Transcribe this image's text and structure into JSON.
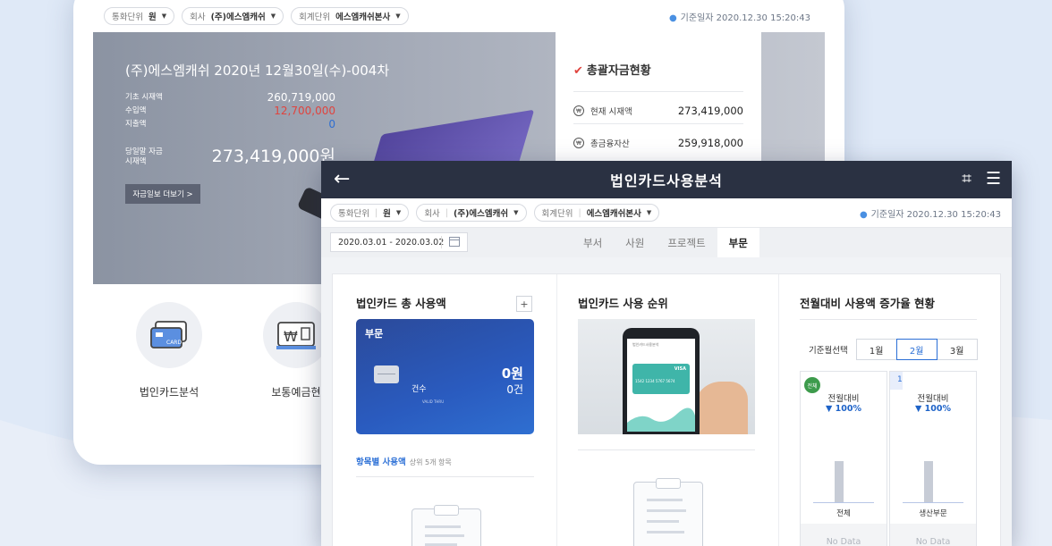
{
  "colors": {
    "header_bg": "#2a3142",
    "accent": "#2b6fd6",
    "negative": "#e0443e",
    "positive": "#2f6fd1",
    "card_blue": "#2a5bbf"
  },
  "back": {
    "filters": [
      {
        "label": "통화단위",
        "value": "원"
      },
      {
        "label": "회사",
        "value": "(주)에스엠캐쉬"
      },
      {
        "label": "회계단위",
        "value": "에스엠캐쉬본사"
      }
    ],
    "base_date": "기준일자 2020.12.30 15:20:43",
    "hero": {
      "title": "(주)에스엠캐쉬 2020년 12월30일(수)-004차",
      "rows": [
        {
          "label": "기초 시재액",
          "value": "260,719,000"
        },
        {
          "label": "수입액",
          "value": "12,700,000"
        },
        {
          "label": "지출액",
          "value": "0"
        }
      ],
      "ending_label_1": "당일말 자금",
      "ending_label_2": "시재액",
      "ending_value": "273,419,000원",
      "more_button": "자금일보 더보기 >"
    },
    "summary": {
      "title": "총괄자금현황",
      "rows": [
        {
          "label": "현재 시재액",
          "value": "273,419,000"
        },
        {
          "label": "총금융자산",
          "value": "259,918,000"
        }
      ]
    },
    "menu": [
      {
        "label": "법인카드분석",
        "icon": "card-icon",
        "icon_text": "CARD"
      },
      {
        "label": "보통예금현",
        "icon": "cash-icon",
        "icon_text": "₩"
      }
    ]
  },
  "front": {
    "title": "법인카드사용분석",
    "filters": [
      {
        "label": "통화단위",
        "value": "원"
      },
      {
        "label": "회사",
        "value": "(주)에스엠캐쉬"
      },
      {
        "label": "회계단위",
        "value": "에스엠캐쉬본사"
      }
    ],
    "base_date": "기준일자 2020.12.30 15:20:43",
    "date_range": "2020.03.01 - 2020.03.02",
    "tabs": [
      "부서",
      "사원",
      "프로젝트",
      "부문"
    ],
    "active_tab": "부문",
    "col1": {
      "title": "법인카드 총 사용액",
      "plus": "+",
      "card_title": "부문",
      "card_amount": "0원",
      "card_count": "0건",
      "count_label": "건수",
      "card_lines": "VALID THRU",
      "sub_title": "항목별 사용액",
      "sub_caption": "상위 5개 항목"
    },
    "col2": {
      "title": "법인카드 사용 순위",
      "phone_brand": "VISA",
      "phone_number": "1542 1234 5767 5674",
      "phone_header": "법인카드사용분석"
    },
    "col3": {
      "title": "전월대비 사용액 증가율 현황",
      "month_label": "기준월선택",
      "months": [
        "1월",
        "2월",
        "3월"
      ],
      "active_month": "2월",
      "stats": [
        {
          "badge": "전체",
          "label": "전월대비",
          "pct": "▼ 100%",
          "name": "전체",
          "nodata": "No Data"
        },
        {
          "badge": "1",
          "label": "전월대비",
          "pct": "▼ 100%",
          "name": "생산부문",
          "nodata": "No Data"
        }
      ]
    }
  }
}
